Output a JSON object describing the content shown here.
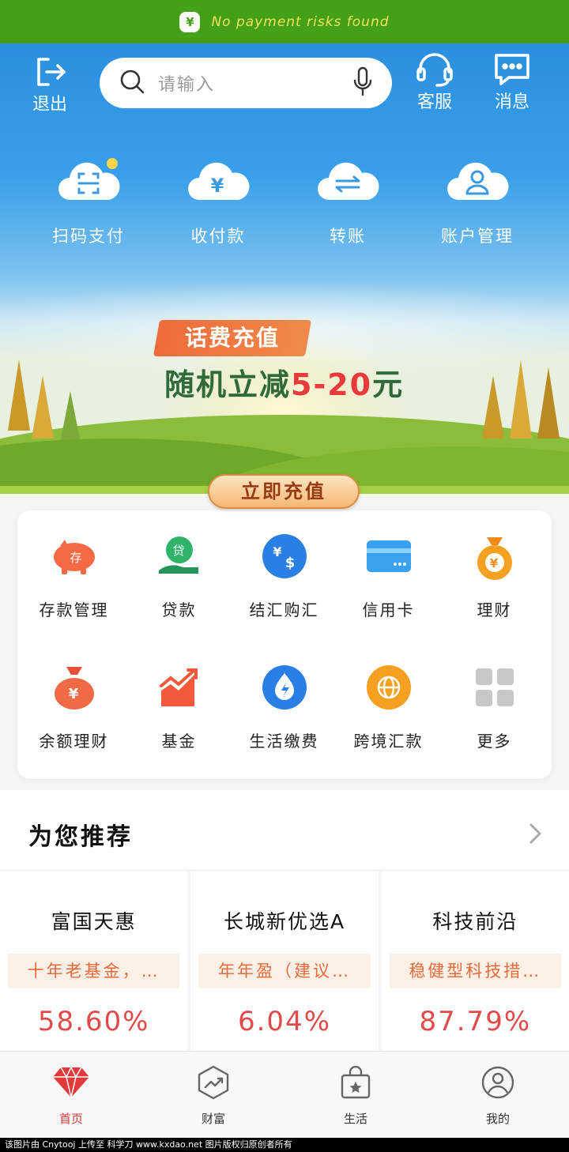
{
  "security_banner": {
    "text": "No payment risks found",
    "icon": "shield-yen-icon"
  },
  "header": {
    "logout_label": "退出",
    "search_placeholder": "请输入",
    "service_label": "客服",
    "message_label": "消息"
  },
  "quick_actions": [
    {
      "label": "扫码支付",
      "icon": "scan-icon"
    },
    {
      "label": "收付款",
      "icon": "yen-icon"
    },
    {
      "label": "转账",
      "icon": "transfer-icon"
    },
    {
      "label": "账户管理",
      "icon": "user-icon"
    }
  ],
  "promo": {
    "tag": "话费充值",
    "main_prefix": "随机立减",
    "main_highlight": "5-20",
    "main_suffix": "元",
    "cta": "立即充值"
  },
  "services": [
    {
      "label": "存款管理",
      "icon": "piggy-bank-icon"
    },
    {
      "label": "贷款",
      "icon": "loan-icon"
    },
    {
      "label": "结汇购汇",
      "icon": "currency-exchange-icon"
    },
    {
      "label": "信用卡",
      "icon": "credit-card-icon"
    },
    {
      "label": "理财",
      "icon": "money-bag-icon"
    },
    {
      "label": "余额理财",
      "icon": "balance-bag-icon"
    },
    {
      "label": "基金",
      "icon": "fund-chart-icon"
    },
    {
      "label": "生活缴费",
      "icon": "utility-icon"
    },
    {
      "label": "跨境汇款",
      "icon": "globe-icon"
    },
    {
      "label": "更多",
      "icon": "grid-icon"
    }
  ],
  "recommend": {
    "title": "为您推荐",
    "cards": [
      {
        "name": "富国天惠",
        "tag": "十年老基金，…",
        "rate": "58.60%"
      },
      {
        "name": "长城新优选A",
        "tag": "年年盈（建议…",
        "rate": "6.04%"
      },
      {
        "name": "科技前沿",
        "tag": "稳健型科技措…",
        "rate": "87.79%"
      }
    ]
  },
  "bottom_nav": [
    {
      "label": "首页",
      "icon": "diamond-icon",
      "active": true
    },
    {
      "label": "财富",
      "icon": "wealth-icon",
      "active": false
    },
    {
      "label": "生活",
      "icon": "shopping-bag-icon",
      "active": false
    },
    {
      "label": "我的",
      "icon": "profile-icon",
      "active": false
    }
  ],
  "footer": {
    "text": "该图片由 Cnytooj 上传至 科学刀 www.kxdao.net 图片版权归原创者所有"
  },
  "colors": {
    "brand_green": "#43a017",
    "accent_red": "#e24a4a",
    "sky_blue": "#2a8fe0",
    "tag_orange": "#ea6a3a"
  }
}
